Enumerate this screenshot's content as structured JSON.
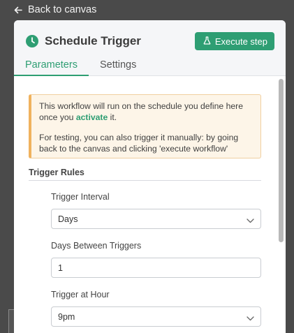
{
  "back": {
    "label": "Back to canvas"
  },
  "panel": {
    "title": "Schedule Trigger",
    "execute_label": "Execute step",
    "tabs": [
      {
        "label": "Parameters",
        "active": true
      },
      {
        "label": "Settings",
        "active": false
      }
    ]
  },
  "notice": {
    "line1_before": "This workflow will run on the schedule you define here once you ",
    "line1_link": "activate",
    "line1_after": " it.",
    "line2": "For testing, you can also trigger it manually: by going back to the canvas and clicking 'execute workflow'"
  },
  "section": {
    "title": "Trigger Rules"
  },
  "fields": {
    "interval": {
      "label": "Trigger Interval",
      "value": "Days"
    },
    "days_between": {
      "label": "Days Between Triggers",
      "value": "1"
    },
    "hour": {
      "label": "Trigger at Hour",
      "value": "9pm"
    }
  },
  "colors": {
    "accent": "#2e9e73",
    "notice_bg": "#fdf5e8",
    "notice_border": "#f0b25e"
  },
  "icons": {
    "back": "arrow-left-icon",
    "title": "clock-icon",
    "execute": "flask-icon",
    "dropdown": "chevron-down-icon"
  }
}
